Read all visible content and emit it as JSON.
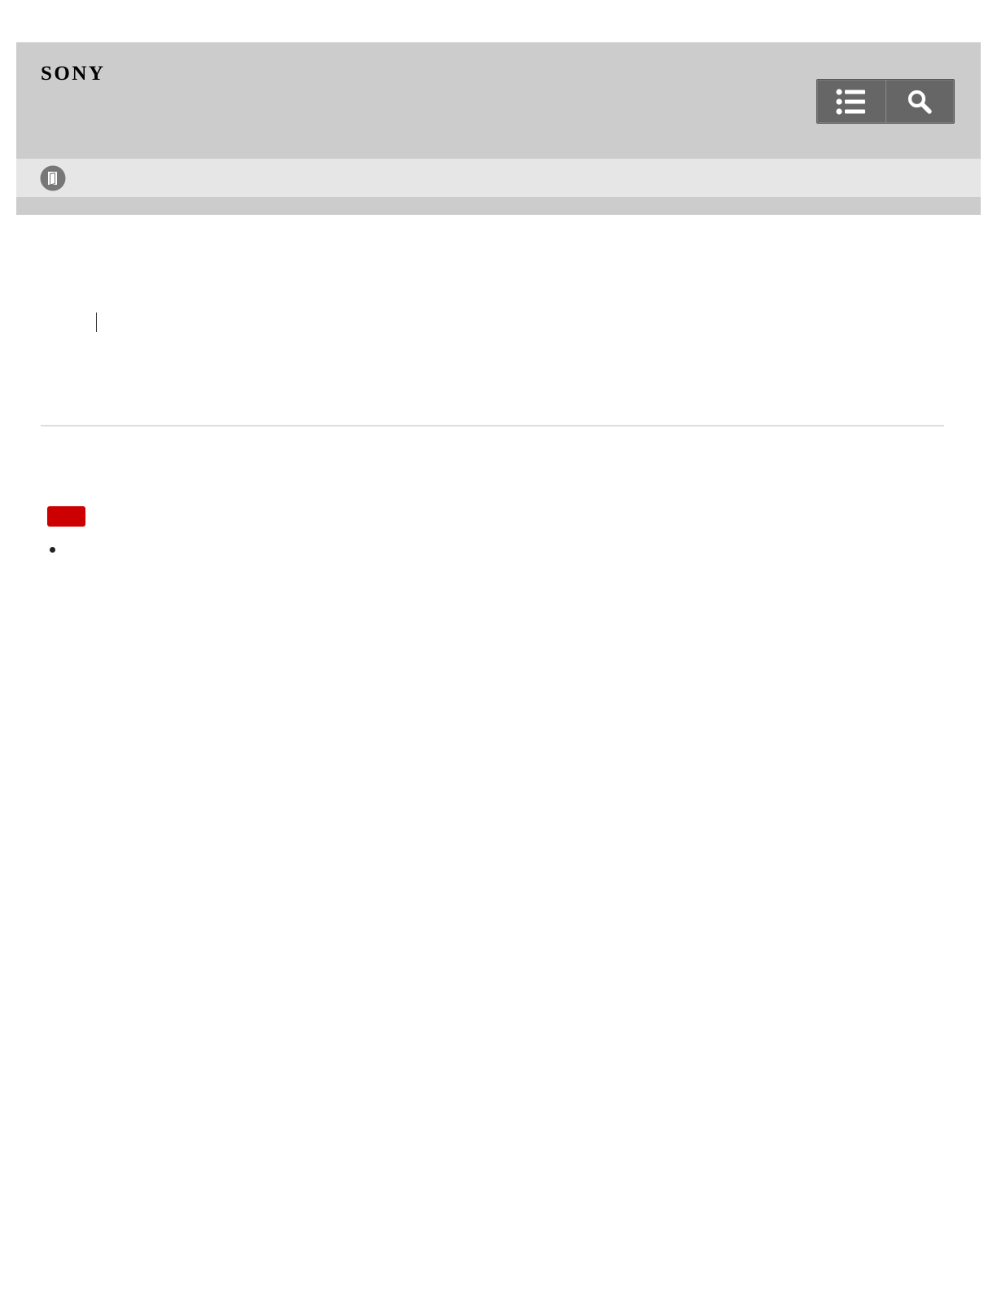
{
  "header": {
    "brand": "SONY",
    "colors": {
      "header_bg": "#cccccc",
      "subbar_bg": "#e6e6e6",
      "button_bg": "#666666",
      "note_badge": "#cc0000"
    }
  },
  "toolbar": {
    "buttons": [
      {
        "name": "table-of-contents",
        "icon": "list-icon"
      },
      {
        "name": "search",
        "icon": "search-icon"
      }
    ]
  },
  "subbar": {
    "icon": "manual-book-icon"
  },
  "content": {
    "note_badge_label": "",
    "bullet_items": [
      ""
    ]
  }
}
